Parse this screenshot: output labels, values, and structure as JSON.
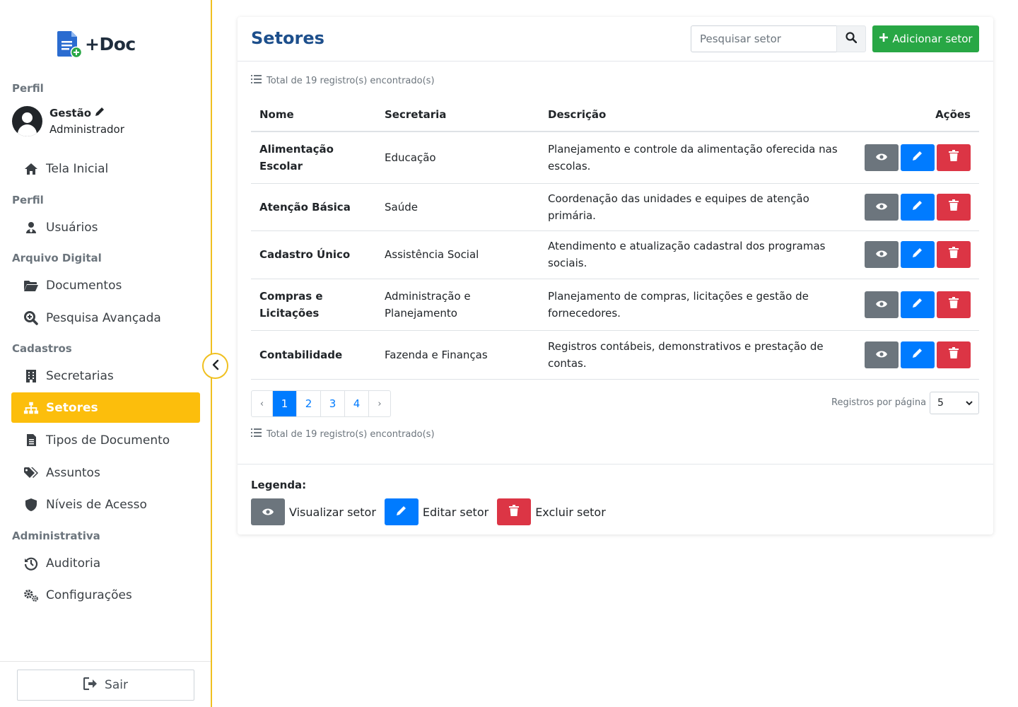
{
  "app": {
    "name": "+Doc"
  },
  "sidebar": {
    "profile_section": "Perfil",
    "user_name": "Gestão",
    "user_role": "Administrador",
    "home": "Tela Inicial",
    "section_profile": "Perfil",
    "users": "Usuários",
    "section_archive": "Arquivo Digital",
    "documents": "Documentos",
    "advanced_search": "Pesquisa Avançada",
    "section_records": "Cadastros",
    "departments": "Secretarias",
    "sectors": "Setores",
    "doc_types": "Tipos de Documento",
    "subjects": "Assuntos",
    "access_levels": "Níveis de Acesso",
    "section_admin": "Administrativa",
    "audit": "Auditoria",
    "settings": "Configurações",
    "logout": "Sair"
  },
  "main": {
    "title": "Setores",
    "search_placeholder": "Pesquisar setor",
    "add_button": "Adicionar setor",
    "total_text": "Total de 19 registro(s) encontrado(s)",
    "columns": {
      "name": "Nome",
      "department": "Secretaria",
      "description": "Descrição",
      "actions": "Ações"
    },
    "rows": [
      {
        "name": "Alimentação Escolar",
        "department": "Educação",
        "description": "Planejamento e controle da alimentação oferecida nas escolas."
      },
      {
        "name": "Atenção Básica",
        "department": "Saúde",
        "description": "Coordenação das unidades e equipes de atenção primária."
      },
      {
        "name": "Cadastro Único",
        "department": "Assistência Social",
        "description": "Atendimento e atualização cadastral dos programas sociais."
      },
      {
        "name": "Compras e Licitações",
        "department": "Administração e Planejamento",
        "description": "Planejamento de compras, licitações e gestão de fornecedores."
      },
      {
        "name": "Contabilidade",
        "department": "Fazenda e Finanças",
        "description": "Registros contábeis, demonstrativos e prestação de contas."
      }
    ],
    "pagination": {
      "prev": "‹",
      "next": "›",
      "pages": [
        "1",
        "2",
        "3",
        "4"
      ],
      "current": "1"
    },
    "per_page_label": "Registros por página",
    "per_page_value": "5",
    "legend": {
      "title": "Legenda:",
      "view": "Visualizar setor",
      "edit": "Editar setor",
      "delete": "Excluir setor"
    }
  },
  "colors": {
    "accent": "#fcbe0c",
    "primary": "#007bff",
    "success": "#28a745",
    "danger": "#dc3545",
    "secondary": "#6c757d",
    "title": "#1d4f8c"
  }
}
